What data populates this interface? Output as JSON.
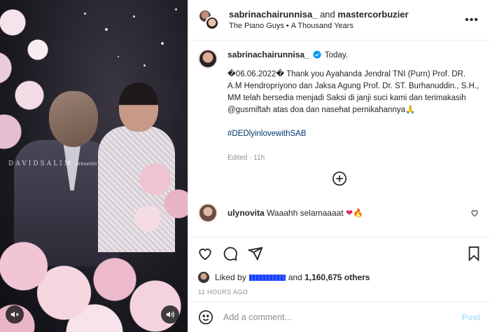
{
  "media": {
    "watermark": "DAVIDSALIM",
    "watermark_suffix": "presents",
    "icons": [
      "mute-icon",
      "volume-icon"
    ]
  },
  "header": {
    "user1": "sabrinachairunnisa_",
    "joiner": "and",
    "user2": "mastercorbuzier",
    "audio_artist": "The Piano Guys",
    "audio_title": "A Thousand Years",
    "more": "•••"
  },
  "caption": {
    "username": "sabrinachairunnisa_",
    "label": "Today.",
    "text": "�06.06.2022� Thank you Ayahanda Jendral TNI (Purn) Prof. DR. A.M Hendropriyono dan Jaksa Agung Prof. Dr. ST. Burhanuddin., S.H., MM telah bersedia menjadi Saksi di janji suci kami dan terimakasih @gusmiftah atas doa dan nasehat pernikahannya🙏",
    "hashtag": "#DEDlyinlovewithSAB",
    "edited": "Edited",
    "time": "11h"
  },
  "comment": {
    "username": "ulynovita",
    "text": "Waaahh selamaaaat",
    "emoji": [
      "❤",
      "🔥"
    ]
  },
  "likes": {
    "prefix": "Liked by",
    "middle": "and",
    "count": "1,160,675 others"
  },
  "timestamp": "11 HOURS AGO",
  "add_comment": {
    "placeholder": "Add a comment...",
    "post_label": "Post"
  },
  "colors": {
    "link": "#00376b",
    "verified": "#0095f6",
    "post_disabled": "#b2dffc"
  }
}
